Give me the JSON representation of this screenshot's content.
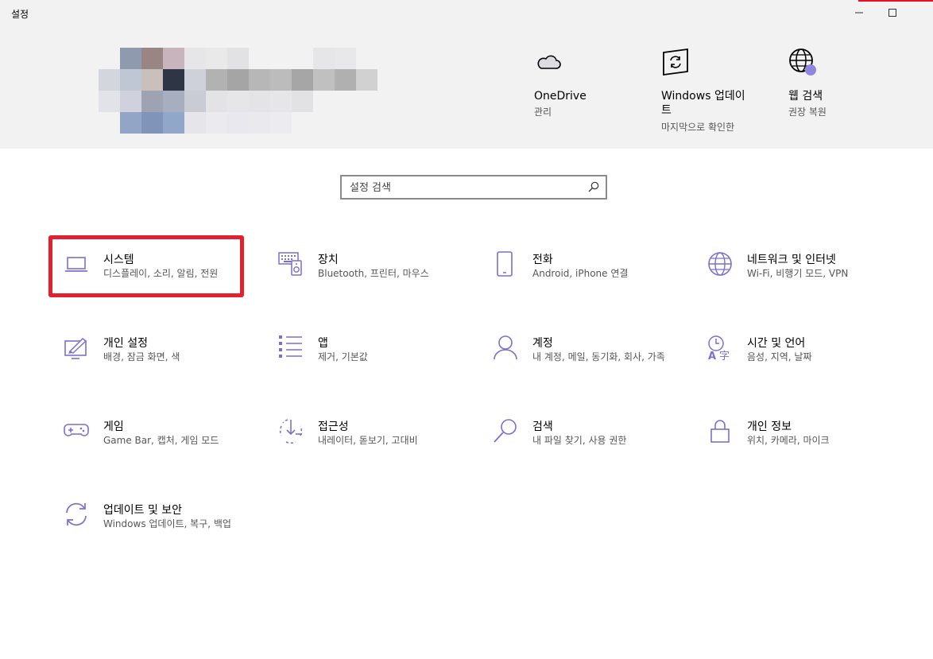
{
  "window": {
    "title": "설정",
    "accent_close": "#e81123"
  },
  "header": {
    "quick_links": [
      {
        "icon": "onedrive-cloud-icon",
        "title": "OneDrive",
        "subtitle": "관리"
      },
      {
        "icon": "windows-update-icon",
        "title": "Windows 업데이트",
        "title_line1": "Windows 업데이",
        "title_line2": "트",
        "subtitle": "마지막으로 확인한"
      },
      {
        "icon": "web-search-globe-icon",
        "title": "웹 검색",
        "subtitle": "권장 복원"
      }
    ]
  },
  "search": {
    "placeholder": "설정 검색",
    "value": ""
  },
  "categories": [
    {
      "icon": "laptop-icon",
      "title": "시스템",
      "subtitle": "디스플레이, 소리, 알림, 전원"
    },
    {
      "icon": "keyboard-speaker-icon",
      "title": "장치",
      "subtitle": "Bluetooth, 프린터, 마우스"
    },
    {
      "icon": "phone-icon",
      "title": "전화",
      "subtitle": "Android, iPhone 연결"
    },
    {
      "icon": "globe-icon",
      "title": "네트워크 및 인터넷",
      "subtitle": "Wi-Fi, 비행기 모드, VPN"
    },
    {
      "icon": "personalization-icon",
      "title": "개인 설정",
      "subtitle": "배경, 잠금 화면, 색"
    },
    {
      "icon": "apps-list-icon",
      "title": "앱",
      "subtitle": "제거, 기본값"
    },
    {
      "icon": "person-icon",
      "title": "계정",
      "subtitle": "내 계정, 메일, 동기화, 회사, 가족"
    },
    {
      "icon": "time-language-icon",
      "title": "시간 및 언어",
      "subtitle": "음성, 지역, 날짜"
    },
    {
      "icon": "gamepad-icon",
      "title": "게임",
      "subtitle": "Game Bar, 캡처, 게임 모드"
    },
    {
      "icon": "accessibility-icon",
      "title": "접근성",
      "subtitle": "내레이터, 돋보기, 고대비"
    },
    {
      "icon": "search-icon",
      "title": "검색",
      "subtitle": "내 파일 찾기, 사용 권한"
    },
    {
      "icon": "lock-icon",
      "title": "개인 정보",
      "subtitle": "위치, 카메라, 마이크"
    },
    {
      "icon": "update-sync-icon",
      "title": "업데이트 및 보안",
      "subtitle": "Windows 업데이트, 복구, 백업"
    }
  ],
  "colors": {
    "icon_accent": "#7b6fd0",
    "highlight_border": "#e5202e",
    "header_bg": "#f2f2f2",
    "status_dot": "#8f86e0"
  }
}
